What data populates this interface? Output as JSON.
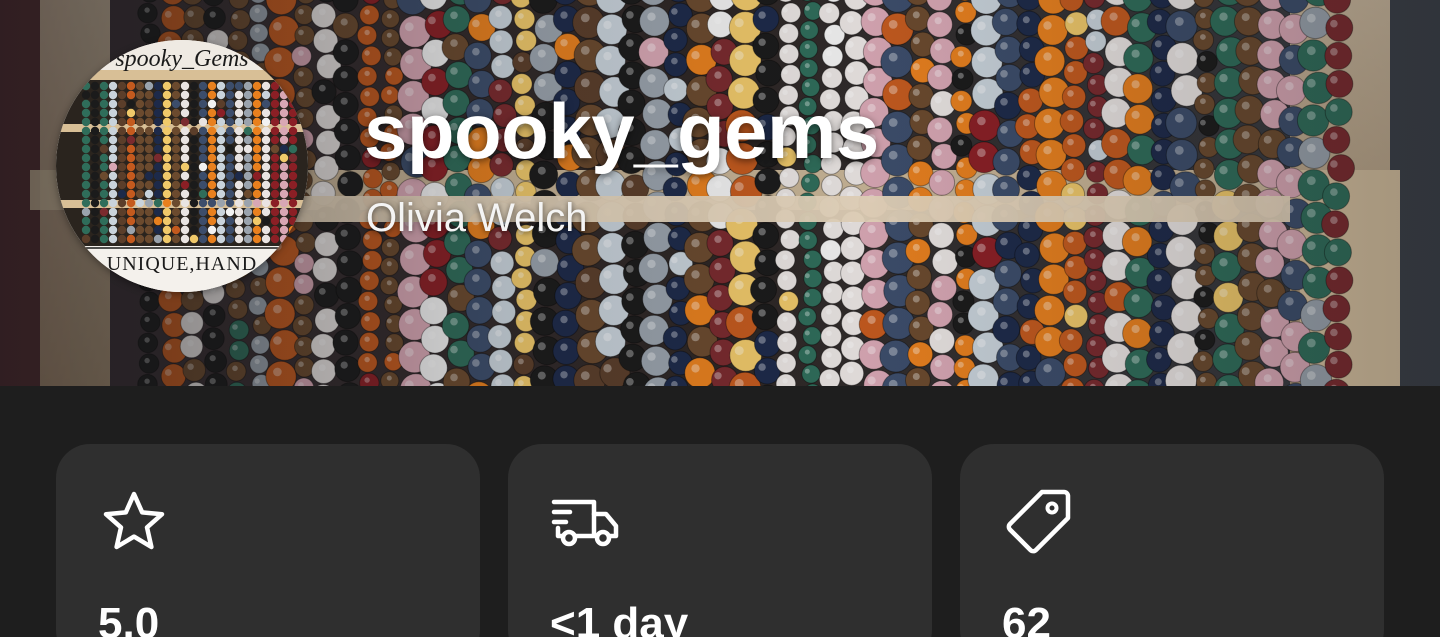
{
  "shop": {
    "name": "spooky_gems",
    "owner": "Olivia Welch",
    "avatar_logo_text": "spooky_Gems",
    "avatar_tagline": "UNIQUE,HAND"
  },
  "stats": [
    {
      "icon": "star-icon",
      "value": "5.0"
    },
    {
      "icon": "delivery-truck-icon",
      "value": "<1 day"
    },
    {
      "icon": "price-tag-icon",
      "value": "62"
    }
  ],
  "colors": {
    "background": "#1e1e1e",
    "card": "#2f2f2f",
    "text": "#ffffff"
  }
}
